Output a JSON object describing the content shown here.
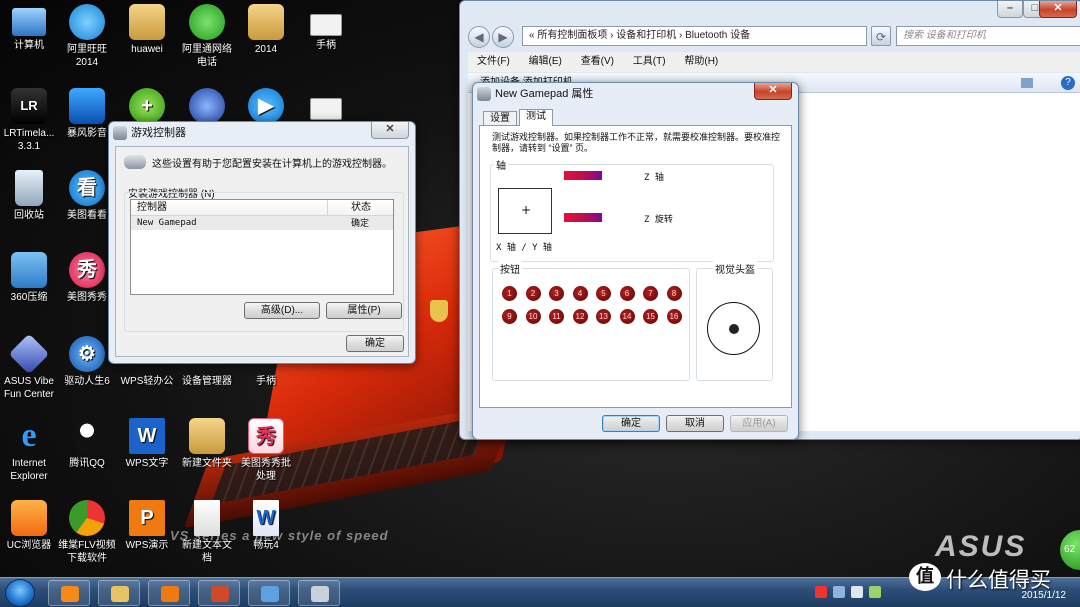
{
  "desktop": {
    "icons": [
      {
        "label": "计算机"
      },
      {
        "label": "阿里旺旺\n2014"
      },
      {
        "label": "huawei"
      },
      {
        "label": "阿里通网络\n电话"
      },
      {
        "label": "2014"
      },
      {
        "label": "手柄"
      },
      {
        "label": "LRTimela...\n3.3.1"
      },
      {
        "label": "暴风影音"
      },
      {
        "label": "回收站"
      },
      {
        "label": "美图看看"
      },
      {
        "label": "360压缩"
      },
      {
        "label": "美图秀秀"
      },
      {
        "label": "ASUS Vibe\nFun Center"
      },
      {
        "label": "驱动人生6"
      },
      {
        "label": "WPS轻办公"
      },
      {
        "label": "设备管理器"
      },
      {
        "label": "手柄"
      },
      {
        "label": "Internet\nExplorer"
      },
      {
        "label": "腾讯QQ"
      },
      {
        "label": "WPS文字"
      },
      {
        "label": "新建文件夹"
      },
      {
        "label": "美图秀秀批\n处理"
      },
      {
        "label": "UC浏览器"
      },
      {
        "label": "维棠FLV视频\n下载软件"
      },
      {
        "label": "WPS演示"
      },
      {
        "label": "新建文本文\n档"
      },
      {
        "label": "畅玩4"
      }
    ],
    "brand": "ASUS",
    "slogan": "VS series  a new style of speed",
    "gadget": "62"
  },
  "explorer": {
    "address": "«  所有控制面板项  ›  设备和打印机  ›  Bluetooth 设备",
    "search_placeholder": "搜索 设备和打印机",
    "menu": [
      "文件(F)",
      "编辑(E)",
      "查看(V)",
      "工具(T)",
      "帮助(H)"
    ],
    "toolbar": "添加设备     添加打印机"
  },
  "game_controllers": {
    "title": "游戏控制器",
    "description": "这些设置有助于您配置安装在计算机上的游戏控制器。",
    "group_label": "安装游戏控制器 (N)",
    "columns": [
      "控制器",
      "状态"
    ],
    "rows": [
      {
        "name": "New Gamepad",
        "status": "确定"
      }
    ],
    "btn_advanced": "高级(D)...",
    "btn_properties": "属性(P)",
    "btn_ok": "确定"
  },
  "gamepad_props": {
    "title": "New Gamepad 属性",
    "tabs": [
      "设置",
      "测试"
    ],
    "instructions": "测试游戏控制器。如果控制器工作不正常，就需要校准控制器。要校准控制器，请转到 “设置” 页。",
    "axes_label": "轴",
    "z_axis": "Z 轴",
    "z_rotation": "Z 旋转",
    "xy_axis": "X 轴 / Y 轴",
    "crosshair": "+",
    "buttons_label": "按钮",
    "hat_label": "视觉头盔",
    "buttons": [
      "1",
      "2",
      "3",
      "4",
      "5",
      "6",
      "7",
      "8",
      "9",
      "10",
      "11",
      "12",
      "13",
      "14",
      "15",
      "16"
    ],
    "btn_ok": "确定",
    "btn_cancel": "取消",
    "btn_apply": "应用(A)"
  },
  "taskbar": {
    "date": "2015/1/12"
  },
  "watermark": {
    "logo": "值",
    "text": "什么值得买"
  }
}
